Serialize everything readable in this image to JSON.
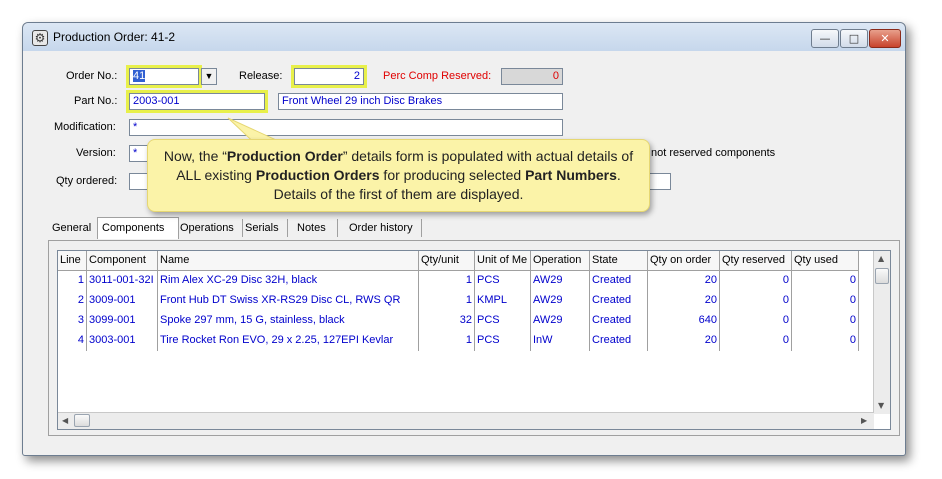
{
  "window": {
    "title": "Production Order: 41-2",
    "minimize_glyph": "—",
    "maximize_glyph": "□",
    "close_glyph": "✕"
  },
  "form": {
    "order_no_label": "Order No.:",
    "order_no_value": "41",
    "release_label": "Release:",
    "release_value": "2",
    "perc_comp_label": "Perc Comp Reserved:",
    "perc_comp_value": "0",
    "part_no_label": "Part No.:",
    "part_no_value": "2003-001",
    "part_desc_value": "Front Wheel 29 inch Disc Brakes",
    "modification_label": "Modification:",
    "modification_value": "*",
    "version_label": "Version:",
    "version_value": "*",
    "qty_ordered_label": "Qty ordered:",
    "qty_ordered_value": "",
    "not_reserved_text": "not reserved components"
  },
  "tabs": [
    {
      "label": "General"
    },
    {
      "label": "Components"
    },
    {
      "label": "Operations"
    },
    {
      "label": "Serials"
    },
    {
      "label": "Notes"
    },
    {
      "label": "Order history"
    }
  ],
  "table": {
    "columns": [
      "Line",
      "Component",
      "Name",
      "Qty/unit",
      "Unit of Me",
      "Operation",
      "State",
      "Qty on order",
      "Qty reserved",
      "Qty used"
    ],
    "rows": [
      [
        "1",
        "3011-001-32I",
        "Rim Alex XC-29 Disc 32H, black",
        "1",
        "PCS",
        "AW29",
        "Created",
        "20",
        "0",
        "0"
      ],
      [
        "2",
        "3009-001",
        "Front Hub DT Swiss XR-RS29 Disc CL, RWS QR",
        "1",
        "KMPL",
        "AW29",
        "Created",
        "20",
        "0",
        "0"
      ],
      [
        "3",
        "3099-001",
        "Spoke 297 mm, 15 G, stainless, black",
        "32",
        "PCS",
        "AW29",
        "Created",
        "640",
        "0",
        "0"
      ],
      [
        "4",
        "3003-001",
        "Tire Rocket Ron EVO, 29 x 2.25, 127EPI Kevlar",
        "1",
        "PCS",
        "InW",
        "Created",
        "20",
        "0",
        "0"
      ]
    ]
  },
  "callout": {
    "t1": "Now, the “",
    "b1": "Production Order",
    "t2": "” details form is populated with actual details of ALL existing ",
    "b2": "Production Orders",
    "t3": " for producing selected ",
    "b3": "Part Numbers",
    "t4": ".  Details of the first of them are displayed."
  },
  "colors": {
    "highlight": "#e8f04a",
    "callout_bg": "#fbf3a8",
    "value_text": "#0000cc",
    "label_red": "#e00000"
  }
}
